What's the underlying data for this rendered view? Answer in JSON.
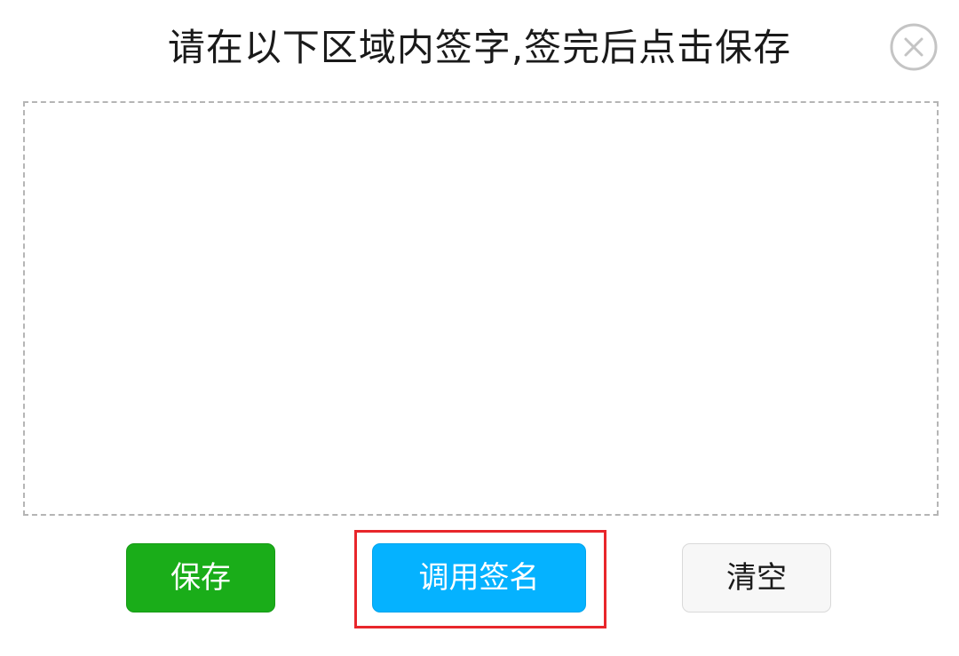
{
  "dialog": {
    "title": "请在以下区域内签字,签完后点击保存",
    "close_icon": "close-circle-icon"
  },
  "signature_pad": {
    "value": ""
  },
  "actions": {
    "save_label": "保存",
    "invoke_signature_label": "调用签名",
    "clear_label": "清空"
  },
  "colors": {
    "save_button": "#1aad19",
    "invoke_button": "#05b2ff",
    "clear_button": "#f7f7f7",
    "highlight_box": "#e8262b",
    "dashed_border": "#b5b5b5",
    "close_icon": "#c4c4c4"
  }
}
